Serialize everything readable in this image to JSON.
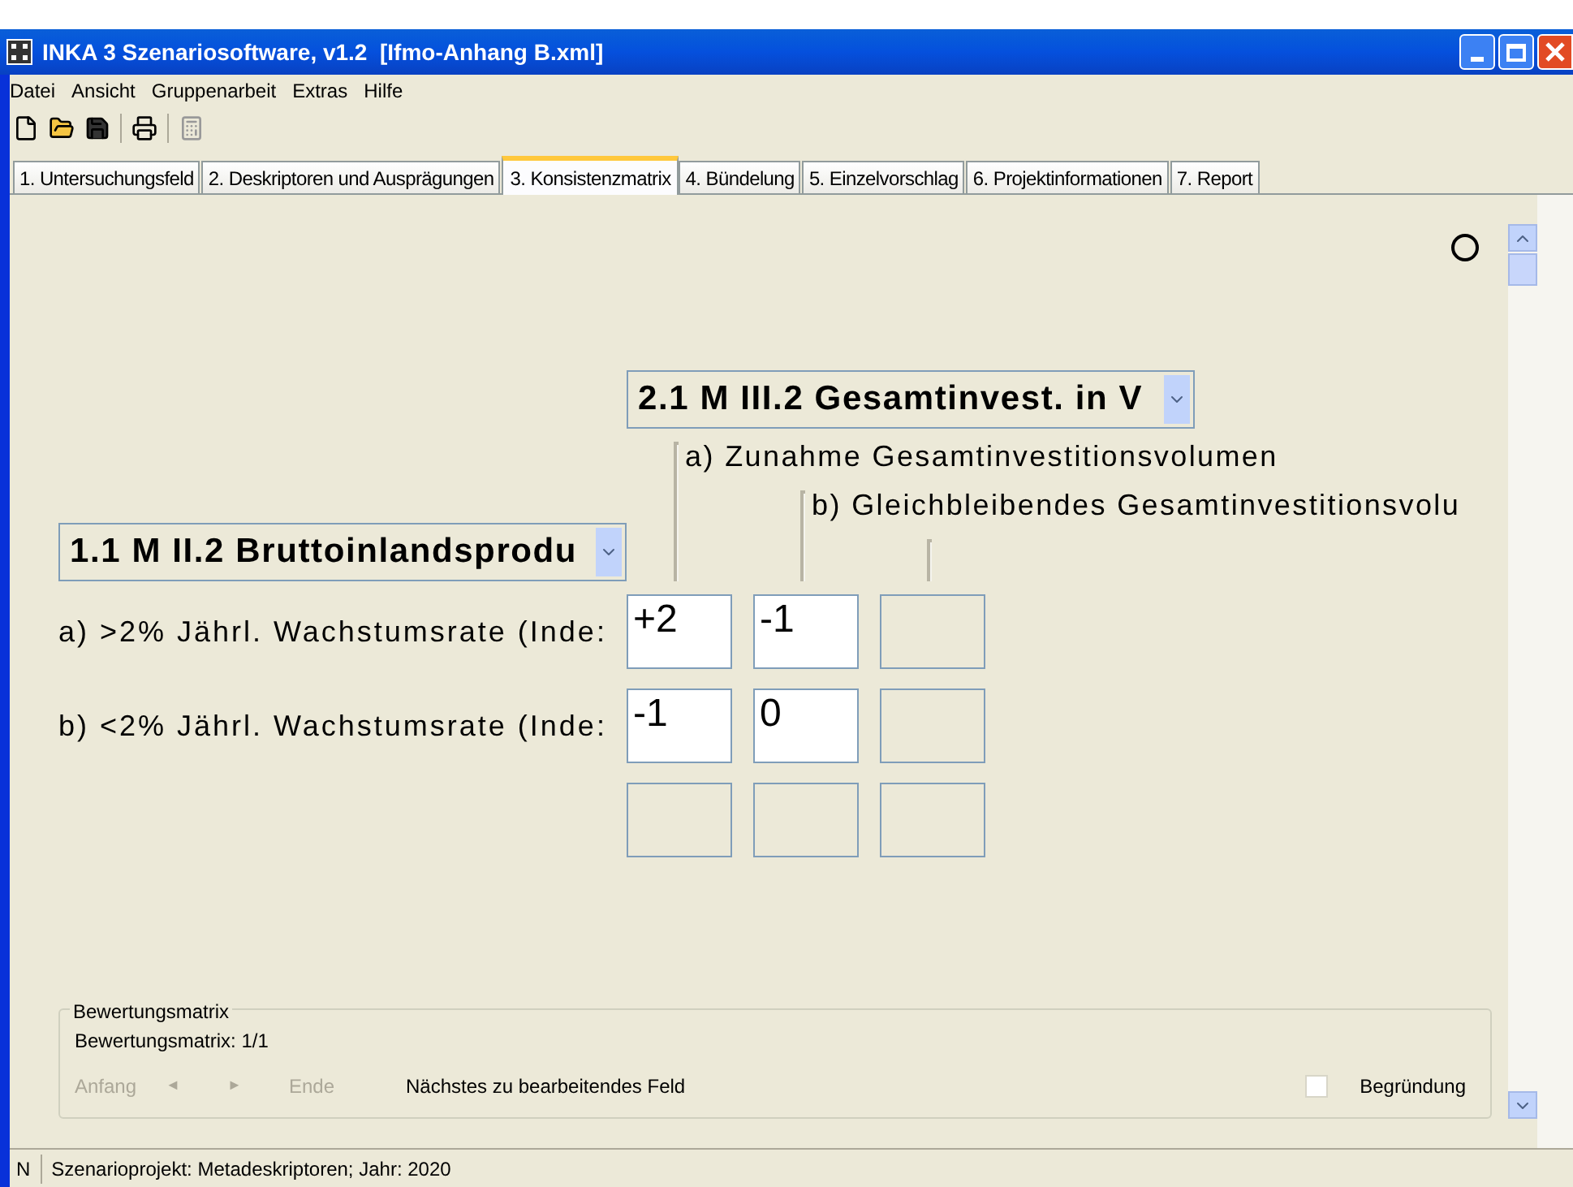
{
  "window": {
    "title": "INKA 3 Szenariosoftware, v1.2  [Ifmo-Anhang B.xml]"
  },
  "menu": [
    "Datei",
    "Ansicht",
    "Gruppenarbeit",
    "Extras",
    "Hilfe"
  ],
  "tabs": [
    {
      "label": "1. Untersuchungsfeld",
      "selected": false
    },
    {
      "label": "2. Deskriptoren und Ausprägungen",
      "selected": false
    },
    {
      "label": "3. Konsistenzmatrix",
      "selected": true
    },
    {
      "label": "4. Bündelung",
      "selected": false
    },
    {
      "label": "5. Einzelvorschlag",
      "selected": false
    },
    {
      "label": "6. Projektinformationen",
      "selected": false
    },
    {
      "label": "7. Report",
      "selected": false
    }
  ],
  "matrix": {
    "column_selector": "2.1 M III.2 Gesamtinvest. in V",
    "column_levels": [
      "a) Zunahme Gesamtinvestitionsvolumen",
      "b) Gleichbleibendes Gesamtinvestitionsvolu"
    ],
    "row_selector": "1.1 M II.2 Bruttoinlandsprodu",
    "rows": [
      {
        "label": "a) >2% Jährl. Wachstumsrate (Inde:",
        "cells": [
          "+2",
          "-1"
        ]
      },
      {
        "label": "b) <2% Jährl. Wachstumsrate (Inde:",
        "cells": [
          "-1",
          "0"
        ]
      }
    ]
  },
  "bewertung": {
    "legend": "Bewertungsmatrix",
    "counter": "Bewertungsmatrix: 1/1",
    "nav": [
      {
        "label": "Anfang",
        "disabled": true
      },
      {
        "label": "◄",
        "disabled": true
      },
      {
        "label": "►",
        "disabled": true
      },
      {
        "label": "Ende",
        "disabled": true
      }
    ],
    "next_field": "Nächstes zu bearbeitendes Feld",
    "checkbox": {
      "label": "Begründung",
      "checked": false
    }
  },
  "status_bar": [
    "N",
    "Szenarioprojekt: Metadeskriptoren; Jahr: 2020"
  ]
}
